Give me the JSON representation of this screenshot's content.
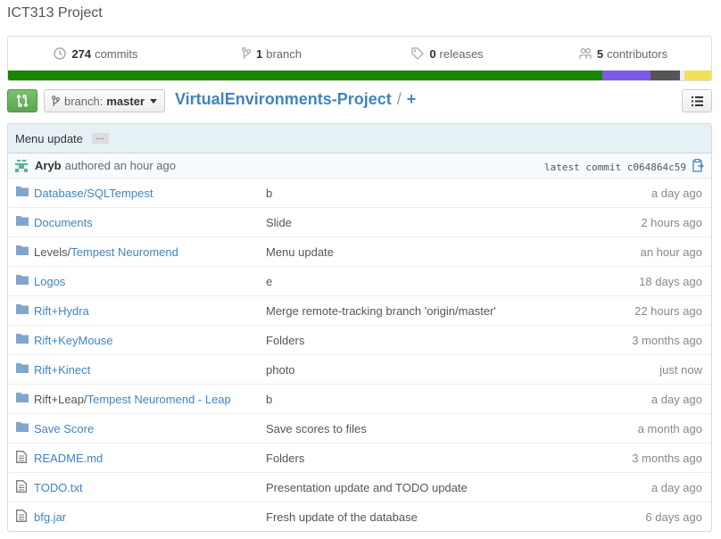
{
  "repo_title": "ICT313 Project",
  "summary": {
    "commits": {
      "count": "274",
      "label": "commits"
    },
    "branch": {
      "count": "1",
      "label": "branch"
    },
    "releases": {
      "count": "0",
      "label": "releases"
    },
    "contributors": {
      "count": "5",
      "label": "contributors"
    }
  },
  "languages": [
    {
      "color": "#178600",
      "share": 0.845
    },
    {
      "color": "#7b5be6",
      "share": 0.069
    },
    {
      "color": "#555555",
      "share": 0.042
    },
    {
      "color": "#eeeeee",
      "share": 0.006
    },
    {
      "color": "#f1e05a",
      "share": 0.038
    }
  ],
  "toolbar": {
    "branch_prefix": "branch:",
    "branch_name": "master",
    "repo_name": "VirtualEnvironments-Project",
    "separator": "/",
    "plus": "+"
  },
  "commit": {
    "message": "Menu update",
    "ellipsis": "…",
    "author": "Aryb",
    "authored": "authored an hour ago",
    "latest_label": "latest commit",
    "sha": "c064864c59"
  },
  "files": [
    {
      "type": "folder",
      "prefix": "",
      "name": "Database/SQLTempest",
      "message": "b",
      "age": "a day ago"
    },
    {
      "type": "folder",
      "prefix": "",
      "name": "Documents",
      "message": "Slide",
      "age": "2 hours ago"
    },
    {
      "type": "folder",
      "prefix": "Levels/",
      "name": "Tempest Neuromend",
      "message": "Menu update",
      "age": "an hour ago"
    },
    {
      "type": "folder",
      "prefix": "",
      "name": "Logos",
      "message": "e",
      "age": "18 days ago"
    },
    {
      "type": "folder",
      "prefix": "",
      "name": "Rift+Hydra",
      "message": "Merge remote-tracking branch 'origin/master'",
      "age": "22 hours ago"
    },
    {
      "type": "folder",
      "prefix": "",
      "name": "Rift+KeyMouse",
      "message": "Folders",
      "age": "3 months ago"
    },
    {
      "type": "folder",
      "prefix": "",
      "name": "Rift+Kinect",
      "message": "photo",
      "age": "just now"
    },
    {
      "type": "folder",
      "prefix": "Rift+Leap/",
      "name": "Tempest Neuromend - Leap",
      "message": "b",
      "age": "a day ago"
    },
    {
      "type": "folder",
      "prefix": "",
      "name": "Save Score",
      "message": "Save scores to files",
      "age": "a month ago"
    },
    {
      "type": "file",
      "prefix": "",
      "name": "README.md",
      "message": "Folders",
      "age": "3 months ago"
    },
    {
      "type": "file",
      "prefix": "",
      "name": "TODO.txt",
      "message": "Presentation update and TODO update",
      "age": "a day ago"
    },
    {
      "type": "file",
      "prefix": "",
      "name": "bfg.jar",
      "message": "Fresh update of the database",
      "age": "6 days ago"
    }
  ]
}
